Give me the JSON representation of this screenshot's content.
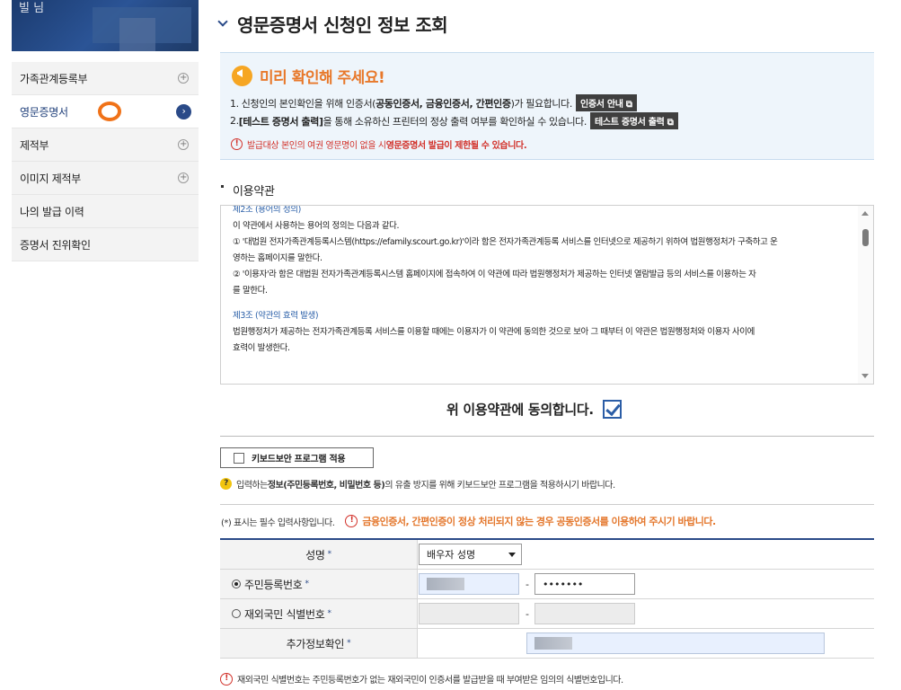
{
  "sidebar": {
    "banner_text": "빌 님",
    "items": [
      {
        "label": "가족관계등록부",
        "has_plus": true
      },
      {
        "label": "영문증명서",
        "active": true
      },
      {
        "label": "제적부",
        "has_plus": true
      },
      {
        "label": "이미지 제적부",
        "has_plus": true
      },
      {
        "label": "나의 발급 이력"
      },
      {
        "label": "증명서 진위확인"
      }
    ],
    "plus_symbol": "+",
    "arrow_symbol": "›"
  },
  "page": {
    "title": "영문증명서 신청인 정보 조회"
  },
  "notice": {
    "title": "미리 확인해 주세요!",
    "line1_prefix": "1. 신청인의 본인확인을 위해 인증서(",
    "line1_bold": "공동인증서, 금융인증서, 간편인증",
    "line1_suffix": ")가 필요합니다.",
    "line1_button": "인증서 안내 ⧉",
    "line2_prefix": "2. ",
    "line2_bold": "[테스트 증명서 출력]",
    "line2_suffix": "을 통해 소유하신 프린터의 정상 출력 여부를 확인하실 수 있습니다.",
    "line2_button": "테스트 증명서 출력 ⧉",
    "warning_text": "발급대상 본인의 여권 영문명이 없을 시 ",
    "warning_bold": "영문증명서 발급이 제한될 수 있습니다."
  },
  "terms": {
    "section_title": "이용약관",
    "article2_title": "제2조 (용어의 정의)",
    "line1": "이 약관에서 사용하는 용어의 정의는 다음과 같다.",
    "line2": "① '대법원 전자가족관계등록시스템(https://efamily.scourt.go.kr)'이라 함은 전자가족관계등록 서비스를 인터넷으로 제공하기 위하여 법원행정처가 구축하고 운",
    "line3": "영하는 홈페이지를 말한다.",
    "line4": "② '이용자'라 함은 대법원 전자가족관계등록시스템 홈페이지에 접속하여 이 약관에 따라 법원행정처가 제공하는 인터넷 열람발급 등의 서비스를 이용하는 자",
    "line5": "를 말한다.",
    "article3_title": "제3조 (약관의 효력 발생)",
    "line6": "법원행정처가 제공하는 전자가족관계등록 서비스를 이용할 때에는 이용자가 이 약관에 동의한 것으로 보아 그 때부터 이 약관은 법원행정처와 이용자 사이에",
    "line7": "효력이 발생한다."
  },
  "agree": {
    "label": "위 이용약관에 동의합니다.",
    "checked": true
  },
  "keyboard_security": {
    "button_label": "키보드보안 프로그램 적용",
    "help_prefix": "입력하는 ",
    "help_bold": "정보(주민등록번호, 비밀번호 등)",
    "help_suffix": "의 유출 방지를 위해 키보드보안 프로그램을 적용하시기 바랍니다."
  },
  "required_note": {
    "text": "(*) 표시는 필수 입력사항입니다.",
    "warning": "금융인증서, 간편인증이 정상 처리되지 않는 경우 공동인증서를 이용하여 주시기 바랍니다."
  },
  "form": {
    "name_label": "성명",
    "rrn_label": "주민등록번호",
    "rrn_back_value": "•••••••",
    "rrn_selected": true,
    "foreign_label": "재외국민 식별번호",
    "extra_label": "추가정보확인",
    "extra_select_value": "배우자 성명",
    "required_mark": "*",
    "dash": "-"
  },
  "footer_note": {
    "text": "재외국민 식별번호는 주민등록번호가 없는 재외국민이 인증서를 발급받을 때 부여받은 임의의 식별번호입니다."
  },
  "colors": {
    "accent_navy": "#2a4a88",
    "notice_bg": "#eef5fb",
    "orange": "#e8782a",
    "warning_red": "#d2312a"
  }
}
